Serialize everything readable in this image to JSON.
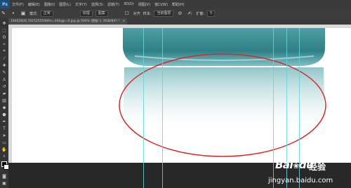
{
  "app": {
    "logo": "Ps"
  },
  "menu": [
    "文件(F)",
    "编辑(E)",
    "图像(I)",
    "图层(L)",
    "文字(Y)",
    "选择(S)",
    "滤镜(T)",
    "3D(D)",
    "视图(V)",
    "窗口(W)",
    "帮助(H)"
  ],
  "options": {
    "mode_label": "模式:",
    "mode_value": "正常",
    "btn_a": "纹理",
    "btn_b": "图案",
    "checkbox_label": "对齐",
    "sample_label": "样本:",
    "sample_value": "当前图层",
    "spread_label": "扩散:",
    "spread_value": "5"
  },
  "document_tab": {
    "title": "18462826,7815255598fm=26&gp=0.jpg @ 500% (图层 1, RGB/8#) *",
    "close": "×"
  },
  "watermark": {
    "brand": "Bai",
    "brand2": "du",
    "jingyan": "经验",
    "url": "jingyan.baidu.com"
  },
  "colors": {
    "guide": "#67d3db",
    "ellipse": "#d62a2a",
    "object": "#3f8f95"
  }
}
